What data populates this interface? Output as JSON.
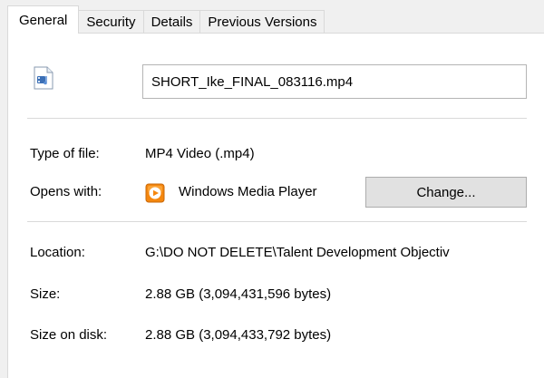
{
  "tabs": [
    {
      "label": "General",
      "active": true
    },
    {
      "label": "Security",
      "active": false
    },
    {
      "label": "Details",
      "active": false
    },
    {
      "label": "Previous Versions",
      "active": false
    }
  ],
  "file": {
    "icon": "video-file-icon",
    "name": "SHORT_Ike_FINAL_083116.mp4"
  },
  "type": {
    "label": "Type of file:",
    "value": "MP4 Video (.mp4)"
  },
  "opens_with": {
    "label": "Opens with:",
    "icon": "windows-media-player-icon",
    "value": "Windows Media Player",
    "button_label": "Change..."
  },
  "location": {
    "label": "Location:",
    "value": "G:\\DO NOT DELETE\\Talent Development Objectiv"
  },
  "size": {
    "label": "Size:",
    "value": "2.88 GB (3,094,431,596 bytes)"
  },
  "size_on_disk": {
    "label": "Size on disk:",
    "value": "2.88 GB (3,094,433,792 bytes)"
  },
  "colors": {
    "tab_border": "#d9d9d9",
    "panel_bg": "#ffffff",
    "window_bg": "#f0f0f0",
    "wmp_orange": "#f5870e",
    "button_bg": "#e1e1e1"
  }
}
